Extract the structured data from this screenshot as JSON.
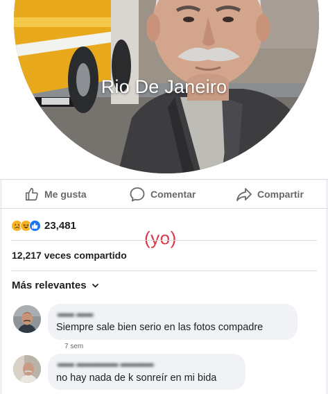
{
  "post": {
    "photo_caption": "Rio De Janeiro"
  },
  "actions": {
    "like": "Me gusta",
    "comment": "Comentar",
    "share": "Compartir"
  },
  "reactions": {
    "icons": [
      "sad-reaction-icon",
      "haha-reaction-icon",
      "like-reaction-icon"
    ],
    "count": "23,481"
  },
  "annotation": "(yo)",
  "shares_text": "12,217 veces compartido",
  "sort": {
    "label": "Más relevantes"
  },
  "comments": [
    {
      "text": "Siempre sale bien serio en las fotos compadre",
      "time": "7 sem"
    },
    {
      "text": "no hay nada de k sonreír en mi bida"
    }
  ],
  "colors": {
    "annotation": "#d93a4a",
    "icon_gray": "#65676b",
    "bubble": "#f0f2f5"
  }
}
